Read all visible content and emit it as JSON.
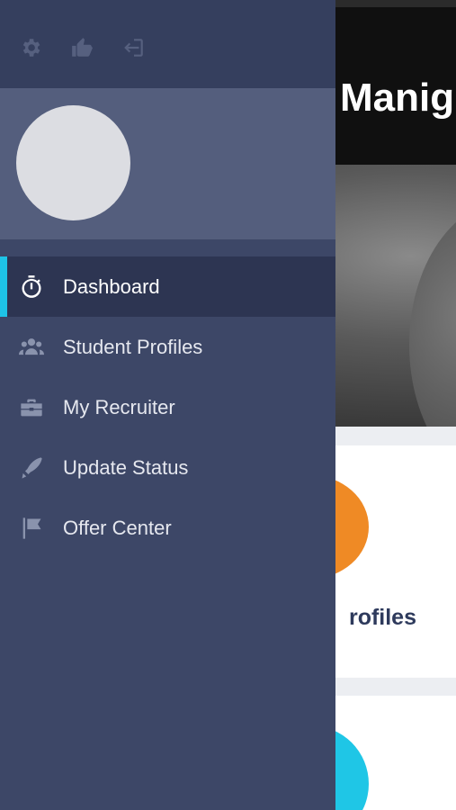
{
  "background_app": {
    "header_title": "Manig",
    "card_label": "rofiles"
  },
  "drawer": {
    "top_icons": [
      "gear-icon",
      "thumbs-up-icon",
      "sign-in-icon"
    ],
    "avatar": "avatar-placeholder",
    "menu": [
      {
        "label": "Dashboard",
        "icon": "stopwatch-icon",
        "active": true
      },
      {
        "label": "Student Profiles",
        "icon": "users-icon",
        "active": false
      },
      {
        "label": "My Recruiter",
        "icon": "briefcase-icon",
        "active": false
      },
      {
        "label": "Update Status",
        "icon": "pen-icon",
        "active": false
      },
      {
        "label": "Offer Center",
        "icon": "flag-icon",
        "active": false
      }
    ]
  },
  "colors": {
    "drawer_bg": "#3d4767",
    "drawer_top_bg": "#353f5e",
    "profile_band_bg": "#545e7d",
    "active_item_bg": "#2d3552",
    "active_indicator": "#1ec3e6",
    "accent_orange": "#ef8a25",
    "accent_blue": "#1fc6e6",
    "card_label_color": "#2e3a5c"
  }
}
